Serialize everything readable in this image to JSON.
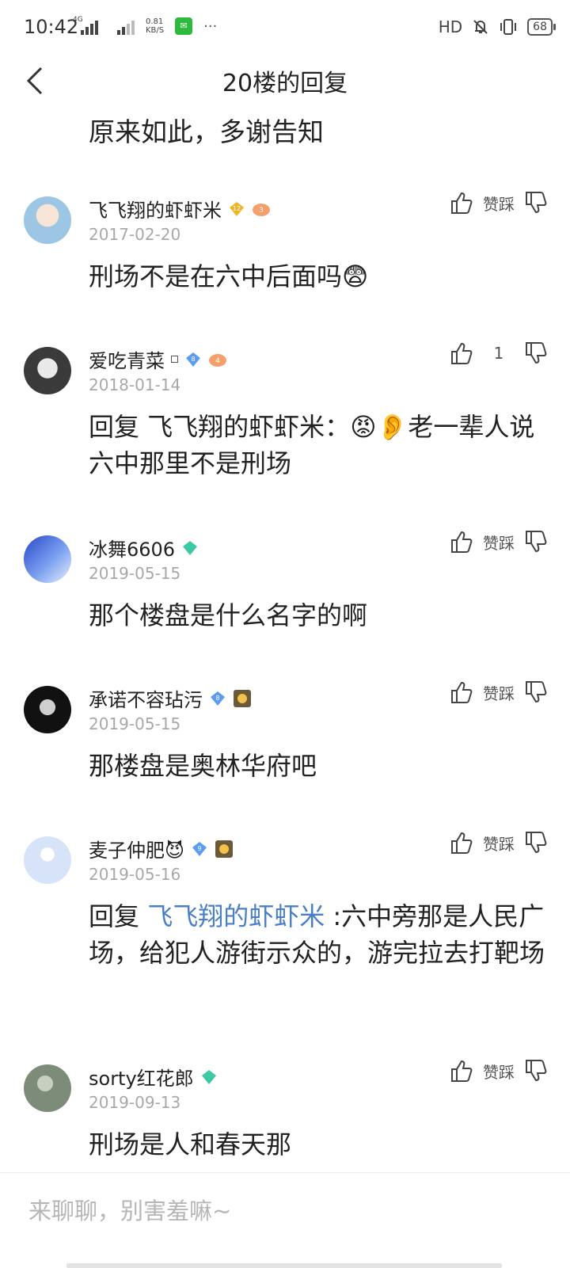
{
  "status_bar": {
    "time": "10:42",
    "network": "4G",
    "speed_top": "0.81",
    "speed_bottom": "KB/S",
    "more": "···",
    "hd": "HD",
    "battery": "68",
    "wechat_icon": "wechat-icon"
  },
  "header": {
    "title": "20楼的回复",
    "back_icon": "chevron-left-icon"
  },
  "top_text": "原来如此，多谢告知",
  "vote_label": "赞踩",
  "comments": [
    {
      "username": "飞飞翔的虾虾米",
      "level": "12",
      "level_color": "#f0b429",
      "badge2": "3",
      "date": "2017-02-20",
      "content": "刑场不是在六中后面吗",
      "emoji": "😨",
      "avatar_color": "#bcd9ee"
    },
    {
      "username": "爱吃青菜",
      "level": "8",
      "level_color": "#5b9cf0",
      "badge2": "4",
      "date": "2018-01-14",
      "like_count": "1",
      "content_prefix": "回复 飞飞翔的虾虾米：",
      "emojis": "😡👂",
      "content": "老一辈人说六中那里不是刑场",
      "avatar_color": "#d4d4d4"
    },
    {
      "username": "冰舞6606",
      "level_color": "#3dc9a4",
      "date": "2019-05-15",
      "content": "那个楼盘是什么名字的啊",
      "avatar_color": "#5c7fe0"
    },
    {
      "username": "承诺不容玷污",
      "level": "8",
      "level_color": "#5b9cf0",
      "date": "2019-05-15",
      "content": "那楼盘是奥林华府吧",
      "avatar_color": "#222222"
    },
    {
      "username": "麦子仲肥",
      "username_emoji": "😈",
      "level": "9",
      "level_color": "#5b9cf0",
      "date": "2019-05-16",
      "content_prefix": "回复",
      "mention": "飞飞翔的虾虾米",
      "content": ":六中旁那是人民广场，给犯人游街示众的，游完拉去打靶场",
      "avatar_color": "#d7e3f8"
    },
    {
      "username": "sorty红花郎",
      "level_color": "#3dc9a4",
      "date": "2019-09-13",
      "content": "刑场是人和春天那",
      "avatar_color": "#7d8c78"
    }
  ],
  "input": {
    "placeholder": "来聊聊，别害羞嘛~"
  }
}
